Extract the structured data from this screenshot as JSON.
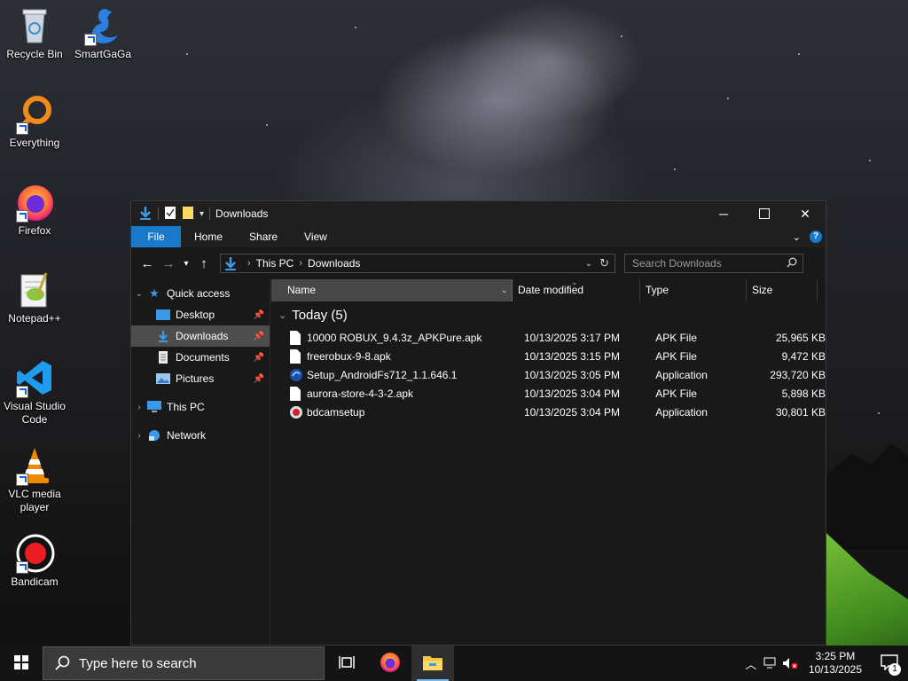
{
  "desktop": {
    "icons": [
      {
        "label": "Recycle Bin"
      },
      {
        "label": "SmartGaGa"
      },
      {
        "label": "Everything"
      },
      {
        "label": "Firefox"
      },
      {
        "label": "Notepad++"
      },
      {
        "label": "Visual Studio Code"
      },
      {
        "label": "VLC media player"
      },
      {
        "label": "Bandicam"
      }
    ]
  },
  "explorer": {
    "title": "Downloads",
    "ribbon_tabs": [
      "File",
      "Home",
      "Share",
      "View"
    ],
    "breadcrumb": [
      "This PC",
      "Downloads"
    ],
    "search_placeholder": "Search Downloads",
    "nav": {
      "quick_access": "Quick access",
      "quick_items": [
        "Desktop",
        "Downloads",
        "Documents",
        "Pictures"
      ],
      "this_pc": "This PC",
      "network": "Network",
      "selected": "Downloads"
    },
    "columns": {
      "name": "Name",
      "date": "Date modified",
      "type": "Type",
      "size": "Size"
    },
    "group_label": "Today (5)",
    "files": [
      {
        "name": "10000 ROBUX_9.4.3z_APKPure.apk",
        "date": "10/13/2025 3:17 PM",
        "type": "APK File",
        "size": "25,965 KB",
        "icon": "file-icon"
      },
      {
        "name": "freerobux-9-8.apk",
        "date": "10/13/2025 3:15 PM",
        "type": "APK File",
        "size": "9,472 KB",
        "icon": "file-icon"
      },
      {
        "name": "Setup_AndroidFs712_1.1.646.1",
        "date": "10/13/2025 3:05 PM",
        "type": "Application",
        "size": "293,720 KB",
        "icon": "installer-icon"
      },
      {
        "name": "aurora-store-4-3-2.apk",
        "date": "10/13/2025 3:04 PM",
        "type": "APK File",
        "size": "5,898 KB",
        "icon": "file-icon"
      },
      {
        "name": "bdcamsetup",
        "date": "10/13/2025 3:04 PM",
        "type": "Application",
        "size": "30,801 KB",
        "icon": "bandicam-setup-icon"
      }
    ]
  },
  "taskbar": {
    "search_placeholder": "Type here to search",
    "time": "3:25 PM",
    "date": "10/13/2025",
    "notification_count": "1"
  },
  "colors": {
    "accent": "#1979ca",
    "window_bg": "#191919",
    "selected_nav": "#4d4d4d"
  }
}
